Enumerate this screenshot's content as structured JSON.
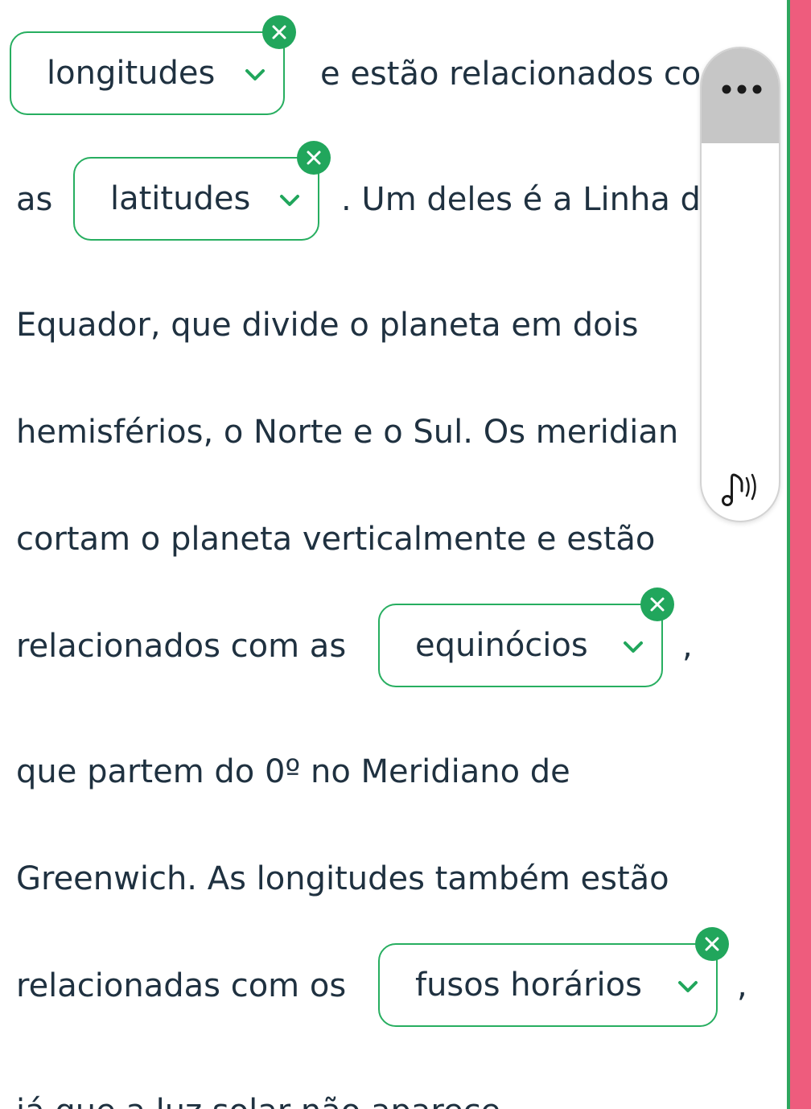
{
  "lines": {
    "l1_after": "e estão relacionados co",
    "l2_before": "as",
    "l2_after": ". Um deles é a Linha d",
    "l3": "Equador, que divide o planeta em dois",
    "l4": "hemisférios, o Norte e o Sul. Os meridian",
    "l5": "cortam o planeta verticalmente e estão",
    "l6_before": "relacionados com as",
    "l6_after": ",",
    "l7": "que partem do 0º no Meridiano de",
    "l8": "Greenwich. As longitudes também estão",
    "l9_before": "relacionadas com os",
    "l9_after": ",",
    "l10": "já que a luz solar não aparece"
  },
  "dropdowns": [
    {
      "value": "longitudes"
    },
    {
      "value": "latitudes"
    },
    {
      "value": "equinócios"
    },
    {
      "value": "fusos horários"
    }
  ],
  "colors": {
    "accent": "#21a65c",
    "border": "#27ae60",
    "text": "#1f3140",
    "edge_pink": "#ee5c7d"
  },
  "icons": {
    "dropdown_chevron": "chevron-down-icon",
    "dropdown_clear": "close-icon",
    "widget_menu": "more-horizontal-icon",
    "widget_audio": "audio-speaker-icon"
  }
}
